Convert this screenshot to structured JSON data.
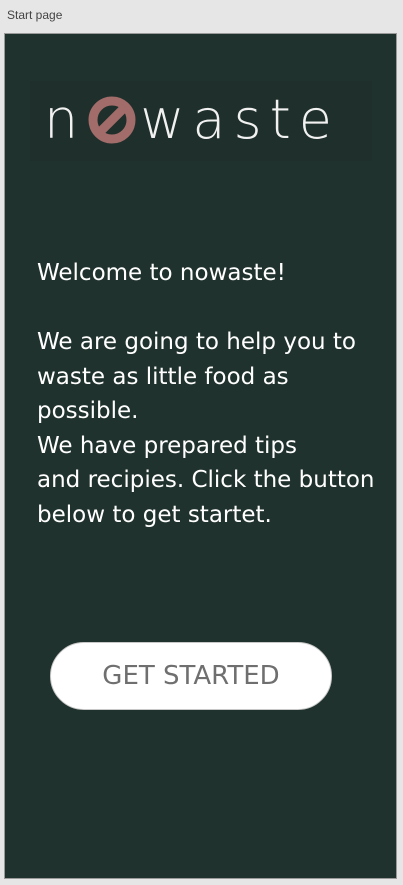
{
  "window": {
    "title": "Start page"
  },
  "logo": {
    "prefix": "n",
    "suffix": "waste",
    "ring_color": "#a16c69",
    "icon": "prohibition-o-icon"
  },
  "intro": {
    "greeting": "Welcome to nowaste!",
    "line1": "We are going to help you to waste as little food as possible.",
    "line2": "We have prepared tips",
    "line3": "and recipies. Click the button below to get startet."
  },
  "cta": {
    "label": "GET STARTED"
  },
  "colors": {
    "background": "#20322d",
    "text": "#ffffff",
    "button_bg": "#ffffff",
    "button_text": "#6f6f6f"
  }
}
